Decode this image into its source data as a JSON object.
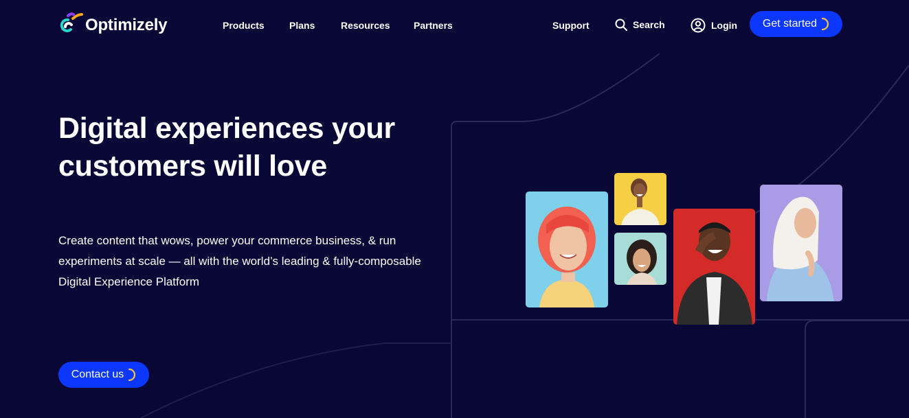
{
  "header": {
    "brand": "Optimizely",
    "nav": [
      {
        "label": "Products"
      },
      {
        "label": "Plans"
      },
      {
        "label": "Resources"
      },
      {
        "label": "Partners"
      }
    ],
    "support_label": "Support",
    "search_label": "Search",
    "login_label": "Login",
    "cta_label": "Get started"
  },
  "hero": {
    "title_line1": "Digital experiences your",
    "title_line2": "customers will love",
    "description_line1": "Create content that wows, power your commerce business, & run",
    "description_line2": "experiments at scale — all with the world’s leading & fully-composable",
    "description_line3": "Digital Experience Platform",
    "cta_label": "Contact us"
  },
  "colors": {
    "background": "#080736",
    "primary_button": "#0b37ff",
    "accent_yellow": "#f5c542",
    "logo_purple": "#8b3cf7",
    "logo_orange": "#f5a623",
    "logo_cyan": "#2ad4c8"
  },
  "icons": {
    "search": "search-icon",
    "login": "user-circle-icon",
    "spinner": "loading-arc-icon"
  }
}
